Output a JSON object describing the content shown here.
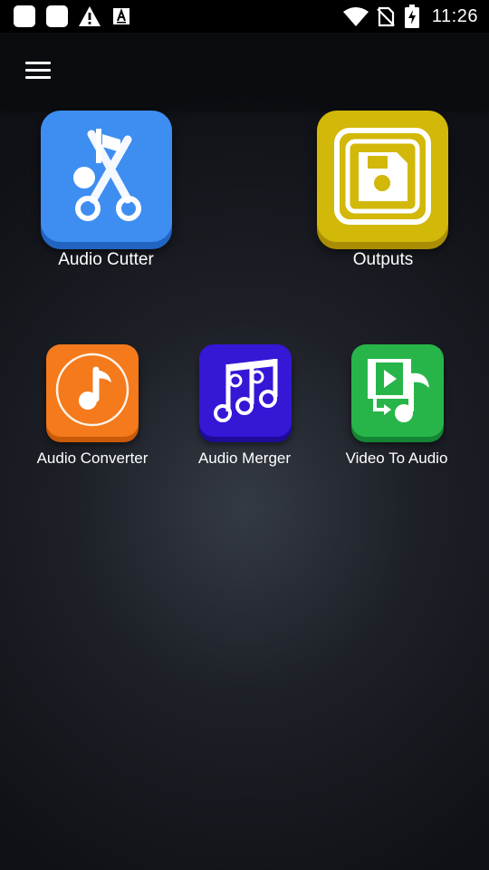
{
  "status_bar": {
    "time": "11:26",
    "icons": [
      "app-square-icon",
      "app-square-icon",
      "warning-icon",
      "font-app-icon",
      "wifi-icon",
      "no-sim-icon",
      "battery-charging-icon"
    ]
  },
  "app_bar": {
    "menu_icon": "hamburger-menu-icon"
  },
  "tiles": [
    {
      "label": "Audio Cutter",
      "icon": "audio-cutter-icon",
      "color": "#3e8ef2"
    },
    {
      "label": "Outputs",
      "icon": "outputs-save-icon",
      "color": "#d2b808"
    },
    {
      "label": "Audio Converter",
      "icon": "audio-converter-icon",
      "color": "#f47a1c"
    },
    {
      "label": "Audio Merger",
      "icon": "audio-merger-icon",
      "color": "#3517d6"
    },
    {
      "label": "Video To Audio",
      "icon": "video-to-audio-icon",
      "color": "#27b54a"
    }
  ]
}
